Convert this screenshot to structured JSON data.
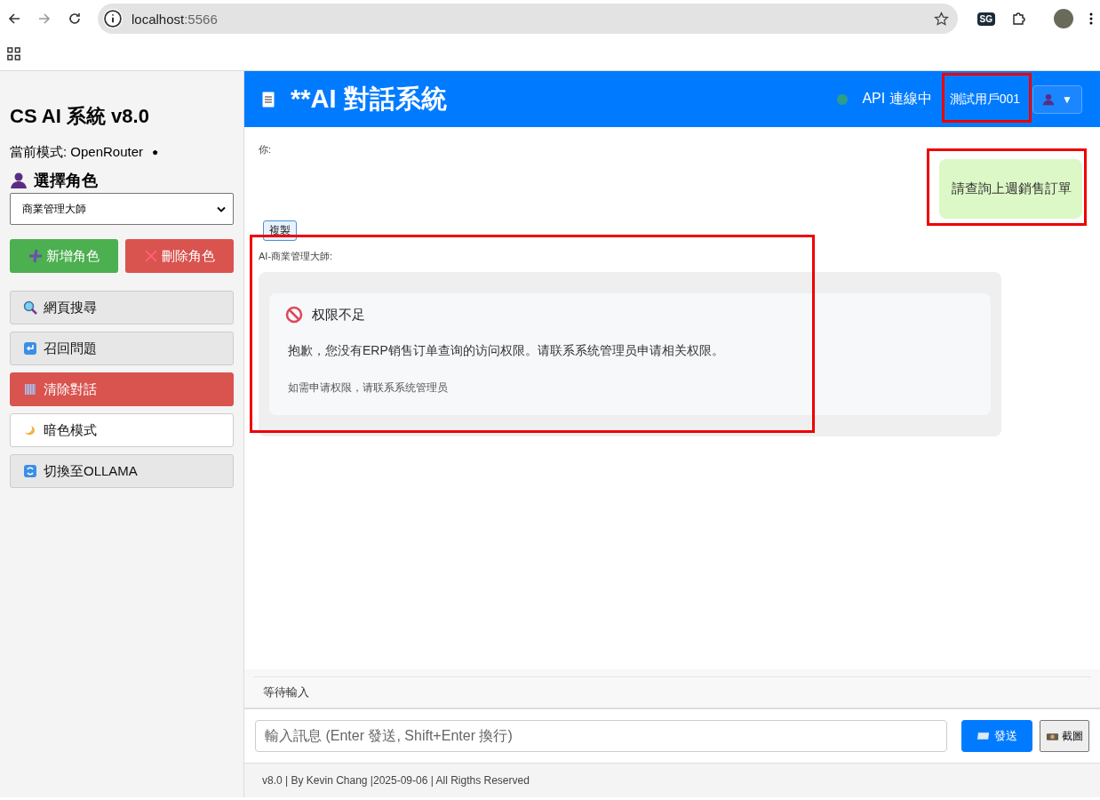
{
  "browser": {
    "url_host": "localhost",
    "url_port": ":5566",
    "profile_badge": "SG"
  },
  "sidebar": {
    "title": "CS AI 系統 v8.0",
    "mode_label": "當前模式: OpenRouter",
    "mode_dot": "●",
    "role_heading": "選擇角色",
    "role_select": "商業管理大師",
    "role_buttons": [
      {
        "label": "新增角色",
        "kind": "success"
      },
      {
        "label": "刪除角色",
        "kind": "danger"
      }
    ],
    "actions": [
      {
        "label": "網頁搜尋",
        "kind": "default"
      },
      {
        "label": "召回問題",
        "kind": "default"
      },
      {
        "label": "清除對話",
        "kind": "danger"
      },
      {
        "label": "暗色模式",
        "kind": "light"
      },
      {
        "label": "切換至OLLAMA",
        "kind": "default"
      }
    ]
  },
  "header": {
    "title": "**AI 對話系統",
    "status": "API 連線中",
    "connected": true,
    "user": "測試用戶001",
    "user_menu": "▼"
  },
  "messages": [
    {
      "kind": "user",
      "sender": "你:",
      "text": "請查詢上週銷售訂單",
      "copy": "複製"
    },
    {
      "kind": "ai",
      "sender": "AI-商業管理大師:",
      "error_title": "权限不足",
      "error_text": "抱歉，您没有ERP销售订单查询的访问权限。请联系系统管理员申请相关权限。",
      "error_hint": "如需申请权限，请联系系统管理员"
    }
  ],
  "status_bar": "等待輸入",
  "composer": {
    "placeholder": "輸入訊息 (Enter 發送, Shift+Enter 換行)",
    "send": "發送",
    "screenshot": "截圖"
  },
  "footer": "v8.0 | By Kevin Chang |2025-09-06 | All Rigths Reserved"
}
